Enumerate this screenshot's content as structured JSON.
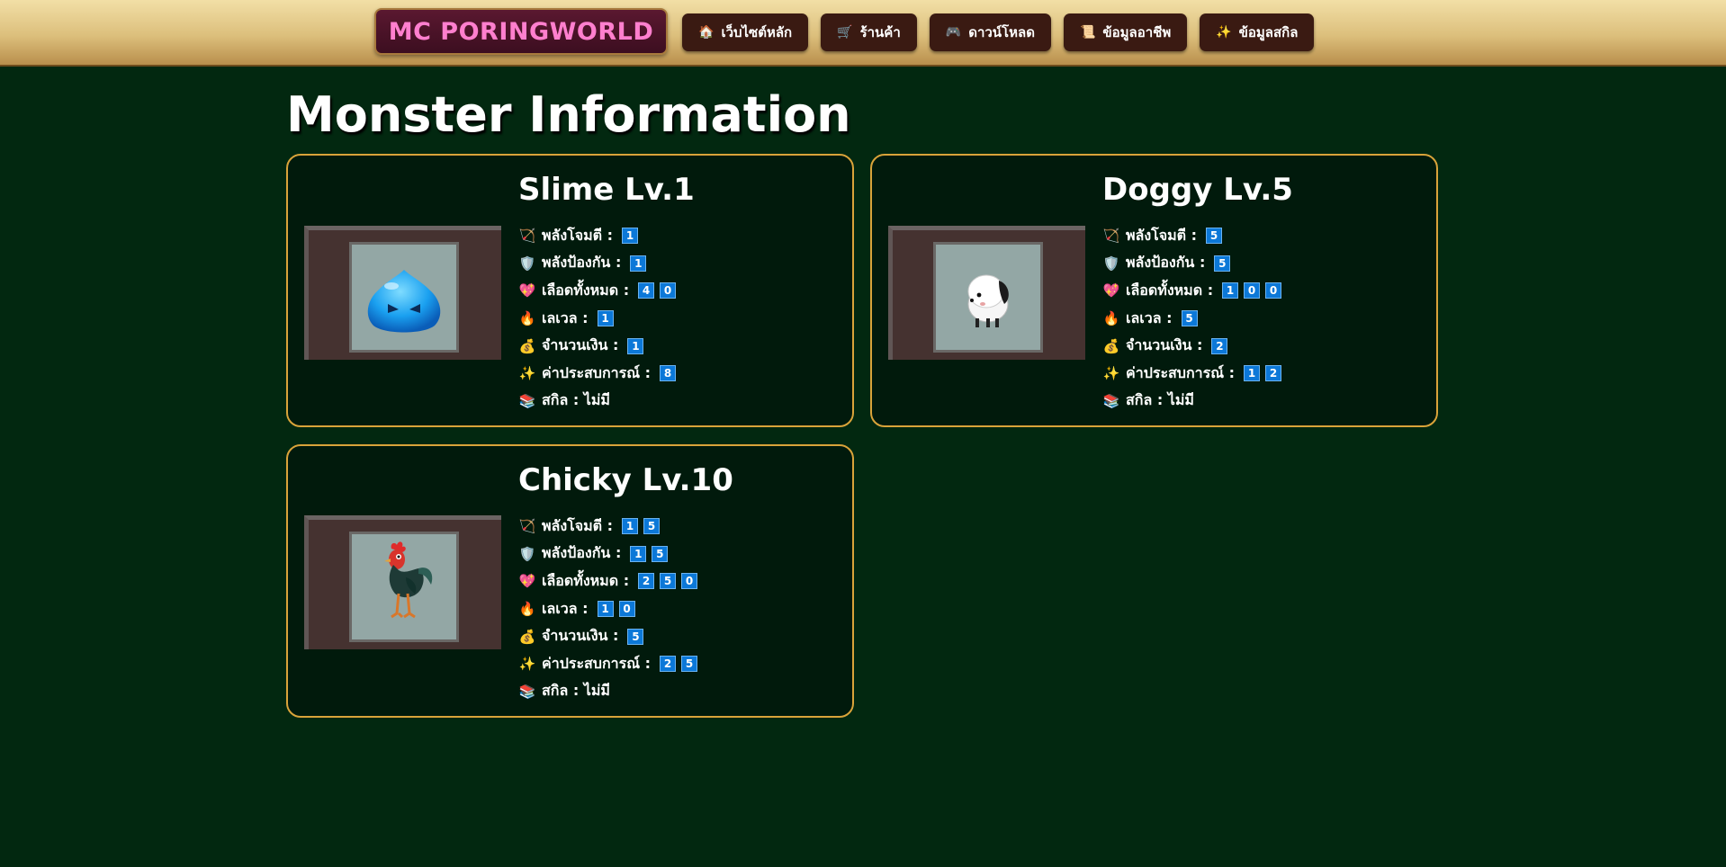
{
  "header": {
    "brand": "MC PORINGWORLD",
    "nav": [
      {
        "icon": "🏠",
        "icon_name": "home-icon",
        "label": "เว็บไซต์หลัก"
      },
      {
        "icon": "🛒",
        "icon_name": "cart-icon",
        "label": "ร้านค้า"
      },
      {
        "icon": "🎮",
        "icon_name": "gamepad-icon",
        "label": "ดาวน์โหลด"
      },
      {
        "icon": "📜",
        "icon_name": "scroll-icon",
        "label": "ข้อมูลอาชีพ"
      },
      {
        "icon": "✨",
        "icon_name": "sparkles-icon",
        "label": "ข้อมูลสกิล"
      }
    ]
  },
  "page": {
    "title": "Monster Information"
  },
  "stat_icons": {
    "attack": "🏹",
    "defense": "🛡️",
    "hp": "💖",
    "level": "🔥",
    "money": "💰",
    "exp": "✨",
    "skill": "📚"
  },
  "monsters": [
    {
      "name": "Slime Lv.1",
      "image": "slime",
      "attack_label": "พลังโจมตี :",
      "attack": [
        "1"
      ],
      "defense_label": "พลังป้องกัน :",
      "defense": [
        "1"
      ],
      "hp_label": "เลือดทั้งหมด :",
      "hp": [
        "4",
        "0"
      ],
      "level_label": "เลเวล :",
      "level": [
        "1"
      ],
      "money_label": "จำนวนเงิน :",
      "money": [
        "1"
      ],
      "exp_label": "ค่าประสบการณ์ :",
      "exp": [
        "8"
      ],
      "skill_label": "สกิล : ไม่มี"
    },
    {
      "name": "Doggy Lv.5",
      "image": "doggy",
      "attack_label": "พลังโจมตี :",
      "attack": [
        "5"
      ],
      "defense_label": "พลังป้องกัน :",
      "defense": [
        "5"
      ],
      "hp_label": "เลือดทั้งหมด :",
      "hp": [
        "1",
        "0",
        "0"
      ],
      "level_label": "เลเวล :",
      "level": [
        "5"
      ],
      "money_label": "จำนวนเงิน :",
      "money": [
        "2"
      ],
      "exp_label": "ค่าประสบการณ์ :",
      "exp": [
        "1",
        "2"
      ],
      "skill_label": "สกิล : ไม่มี"
    },
    {
      "name": "Chicky Lv.10",
      "image": "chicky",
      "attack_label": "พลังโจมตี :",
      "attack": [
        "1",
        "5"
      ],
      "defense_label": "พลังป้องกัน :",
      "defense": [
        "1",
        "5"
      ],
      "hp_label": "เลือดทั้งหมด :",
      "hp": [
        "2",
        "5",
        "0"
      ],
      "level_label": "เลเวล :",
      "level": [
        "1",
        "0"
      ],
      "money_label": "จำนวนเงิน :",
      "money": [
        "5"
      ],
      "exp_label": "ค่าประสบการณ์ :",
      "exp": [
        "2",
        "5"
      ],
      "skill_label": "สกิล : ไม่มี"
    }
  ]
}
